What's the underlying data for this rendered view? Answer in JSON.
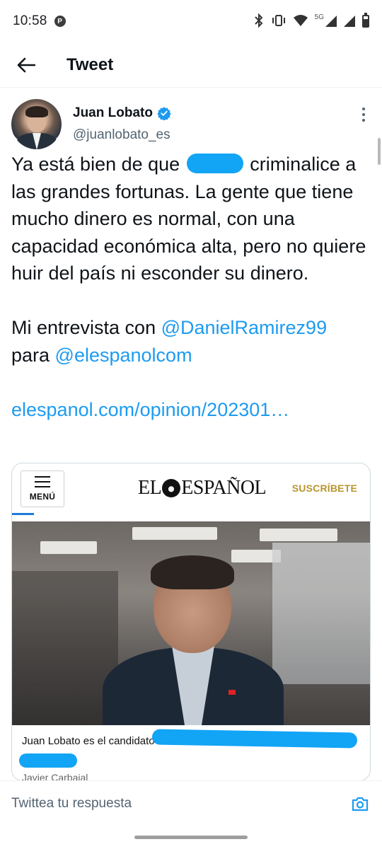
{
  "status_bar": {
    "time": "10:58",
    "network": "5G",
    "icons": [
      "bluetooth-icon",
      "vibrate-icon",
      "wifi-icon",
      "signal-icon",
      "battery-icon"
    ]
  },
  "header": {
    "title": "Tweet",
    "back_icon": "arrow-left-icon"
  },
  "tweet": {
    "author_name": "Juan Lobato",
    "author_handle": "@juanlobato_es",
    "verified": true,
    "text_before_redaction": "Ya está bien de que ",
    "text_after_redaction": " criminalice a las grandes fortunas. La gente que tiene mucho dinero es normal, con una capacidad económica alta, pero no quiere huir del país ni esconder su dinero.",
    "interview_prefix": "Mi entrevista con ",
    "mention_1": "@DanielRamirez99",
    "interview_middle": "para ",
    "mention_2": "@elespanolcom",
    "url": "elespanol.com/opinion/202301…"
  },
  "card": {
    "menu_label": "MENÚ",
    "brand_left": "EL",
    "brand_right": "ESPAÑOL",
    "subscribe": "SUSCRÍBETE",
    "caption": "Juan Lobato es el candidato",
    "author": "Javier Carbajal"
  },
  "reply": {
    "placeholder": "Twittea tu respuesta"
  },
  "colors": {
    "link": "#1d9bf0",
    "redaction": "#12a4f5",
    "subscribe": "#b8962e",
    "verified": "#1d9bf0"
  }
}
